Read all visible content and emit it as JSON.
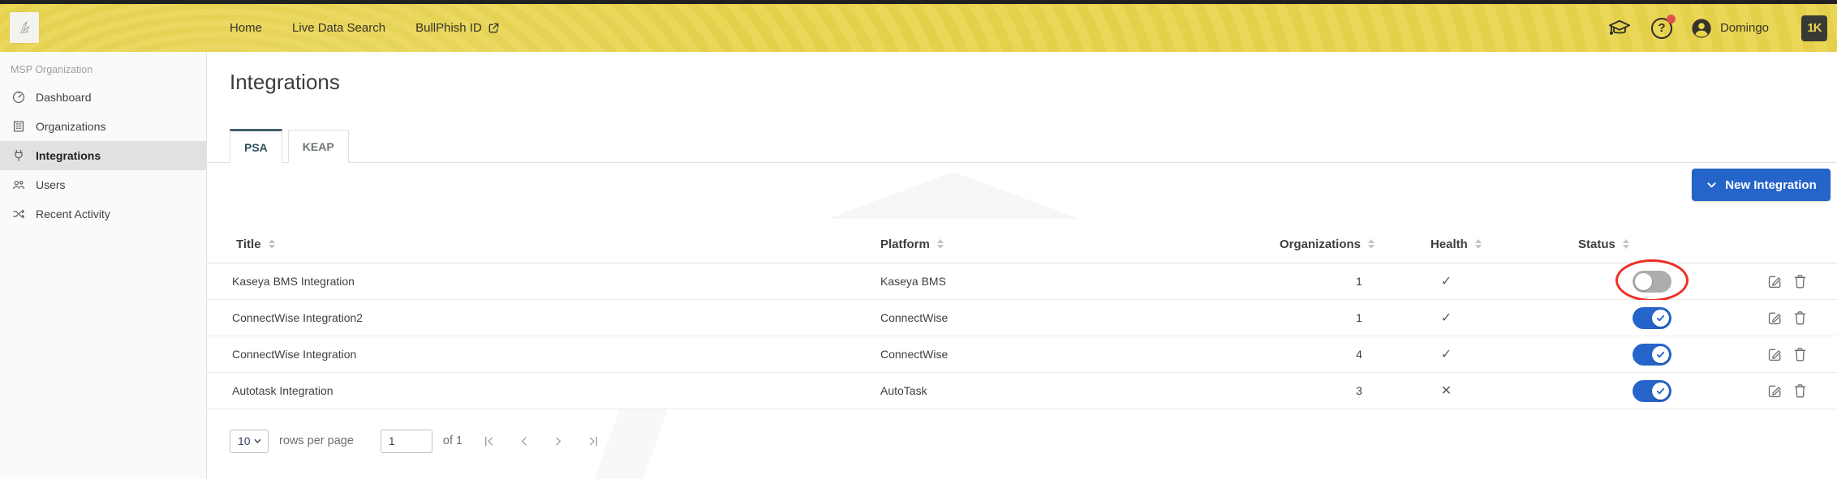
{
  "topbar": {
    "nav_items": [
      "Home",
      "Live Data Search",
      "BullPhish ID"
    ],
    "user_name": "Domingo",
    "brand_logo_text": "1K",
    "help_glyph": "?"
  },
  "sidebar": {
    "section_label": "MSP Organization",
    "items": [
      {
        "label": "Dashboard",
        "icon": "gauge-icon",
        "selected": false
      },
      {
        "label": "Organizations",
        "icon": "building-icon",
        "selected": false
      },
      {
        "label": "Integrations",
        "icon": "plug-icon",
        "selected": true
      },
      {
        "label": "Users",
        "icon": "users-icon",
        "selected": false
      },
      {
        "label": "Recent Activity",
        "icon": "shuffle-icon",
        "selected": false
      }
    ]
  },
  "page": {
    "title": "Integrations",
    "tabs": [
      {
        "label": "PSA",
        "active": true
      },
      {
        "label": "KEAP",
        "active": false
      }
    ],
    "new_integration_button": "New Integration"
  },
  "table": {
    "columns": [
      {
        "label": "Title"
      },
      {
        "label": "Platform"
      },
      {
        "label": "Organizations"
      },
      {
        "label": "Health"
      },
      {
        "label": "Status"
      }
    ],
    "health_glyphs": {
      "check": "✓",
      "cross": "✕"
    },
    "rows": [
      {
        "title": "Kaseya BMS Integration",
        "platform": "Kaseya BMS",
        "organizations": "1",
        "health": "check",
        "status_on": false,
        "annotated": true
      },
      {
        "title": "ConnectWise Integration2",
        "platform": "ConnectWise",
        "organizations": "1",
        "health": "check",
        "status_on": true,
        "annotated": false
      },
      {
        "title": "ConnectWise Integration",
        "platform": "ConnectWise",
        "organizations": "4",
        "health": "check",
        "status_on": true,
        "annotated": false
      },
      {
        "title": "Autotask Integration",
        "platform": "AutoTask",
        "organizations": "3",
        "health": "cross",
        "status_on": true,
        "annotated": false
      }
    ]
  },
  "pagination": {
    "rows_per_page_value": "10",
    "rows_per_page_label": "rows per page",
    "current_page": "1",
    "page_count_label": "of 1"
  },
  "colors": {
    "topbar_yellow": "#e9d44e",
    "accent_blue": "#2564c9",
    "tab_active_border": "#40606d",
    "annotation_red": "#ee2e24",
    "notification_dot": "#e0524e"
  }
}
